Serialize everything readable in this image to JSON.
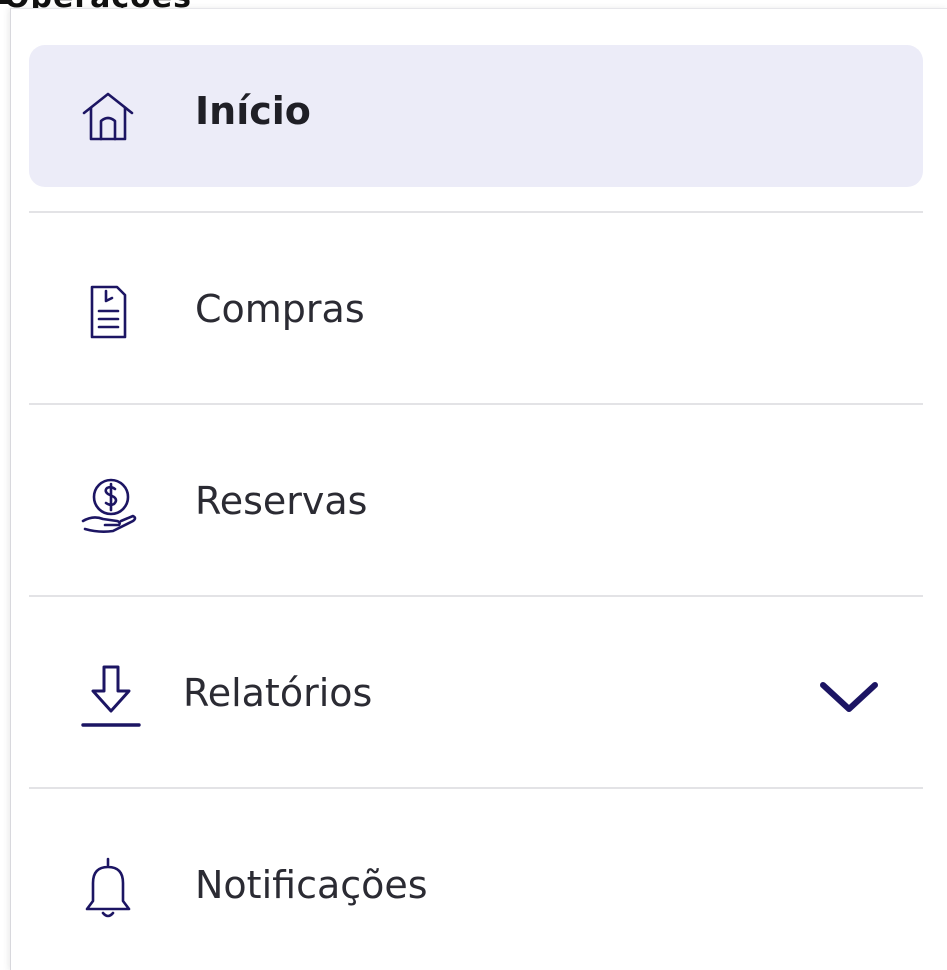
{
  "colors": {
    "accent": "#1c1563",
    "active_bg": "#ececf8",
    "divider": "#e3e3e6",
    "text": "#2b2b33"
  },
  "top_strip": {
    "cut_text": "Operações"
  },
  "menu": {
    "items": [
      {
        "label": "Início",
        "icon": "home-icon",
        "active": true
      },
      {
        "label": "Compras",
        "icon": "document-list-icon",
        "active": false
      },
      {
        "label": "Reservas",
        "icon": "money-hand-icon",
        "active": false
      },
      {
        "label": "Relatórios",
        "icon": "download-icon",
        "active": false,
        "expand_icon": "chevron-down-icon"
      },
      {
        "label": "Notificações",
        "icon": "bell-icon",
        "active": false
      }
    ]
  }
}
